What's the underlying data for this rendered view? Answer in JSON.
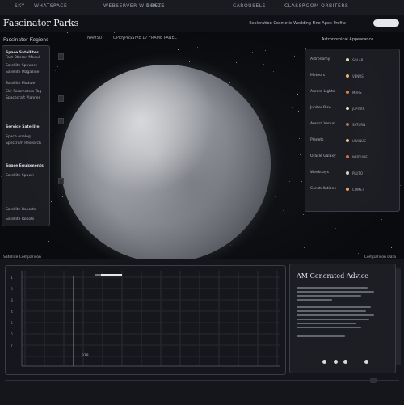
{
  "topnav": {
    "items": [
      "SKY",
      "WHATSPACE",
      "WEBSERVER WIDGETS",
      "SPACE",
      "CAROUSELS",
      "CLASSROOM ORBITERS"
    ]
  },
  "header": {
    "title": "Fascinator Parks",
    "tagline": "Exploration Cosmetic Wedding Fine Apex Profile"
  },
  "search": {
    "placeholder": ""
  },
  "left": {
    "heading": "Fascinator Regions",
    "items": [
      "Space Satellites",
      "Fast Oberon Modul",
      "Satellite Spyware",
      "Satellite Magazine",
      "Satellite Module",
      "Sky Parameters Tag",
      "Spacecraft Planner",
      "Service Satellite",
      "Space Analog",
      "Spectrum Research",
      "Space Equipments",
      "Satellite Spawn",
      "Satellite Reports",
      "Satellite Robots"
    ]
  },
  "viewport": {
    "labels": [
      "NAMSUT",
      "OPEN",
      "PASSIVE 17 FRAME PANEL"
    ]
  },
  "right": {
    "heading": "Astronomical Appearance",
    "items": [
      {
        "label": "Astronomy",
        "sub": "SOLAR"
      },
      {
        "label": "Meteors",
        "sub": "VENUS"
      },
      {
        "label": "Aurora Lights",
        "sub": "MARS"
      },
      {
        "label": "Jupiter Rise",
        "sub": "JUPITER"
      },
      {
        "label": "Aurora Venus",
        "sub": "SATURN"
      },
      {
        "label": "Planets",
        "sub": "URANUS"
      },
      {
        "label": "Oracle Galaxy",
        "sub": "NEPTUNE"
      },
      {
        "label": "Weekdays",
        "sub": "PLUTO"
      },
      {
        "label": "Constellations",
        "sub": "COMET"
      }
    ]
  },
  "chart": {
    "tab": "Satellite Comparison",
    "yticks": [
      "1",
      "2",
      "3",
      "4",
      "5",
      "6",
      "7"
    ],
    "marker_label": "978"
  },
  "ai": {
    "tab": "Comparison Data",
    "title": "AM Generated Advice"
  },
  "colors": {
    "accent": "#e6e7ea",
    "background": "#0b0c10",
    "panel": "#1e1f25",
    "border": "#3a3d46"
  }
}
